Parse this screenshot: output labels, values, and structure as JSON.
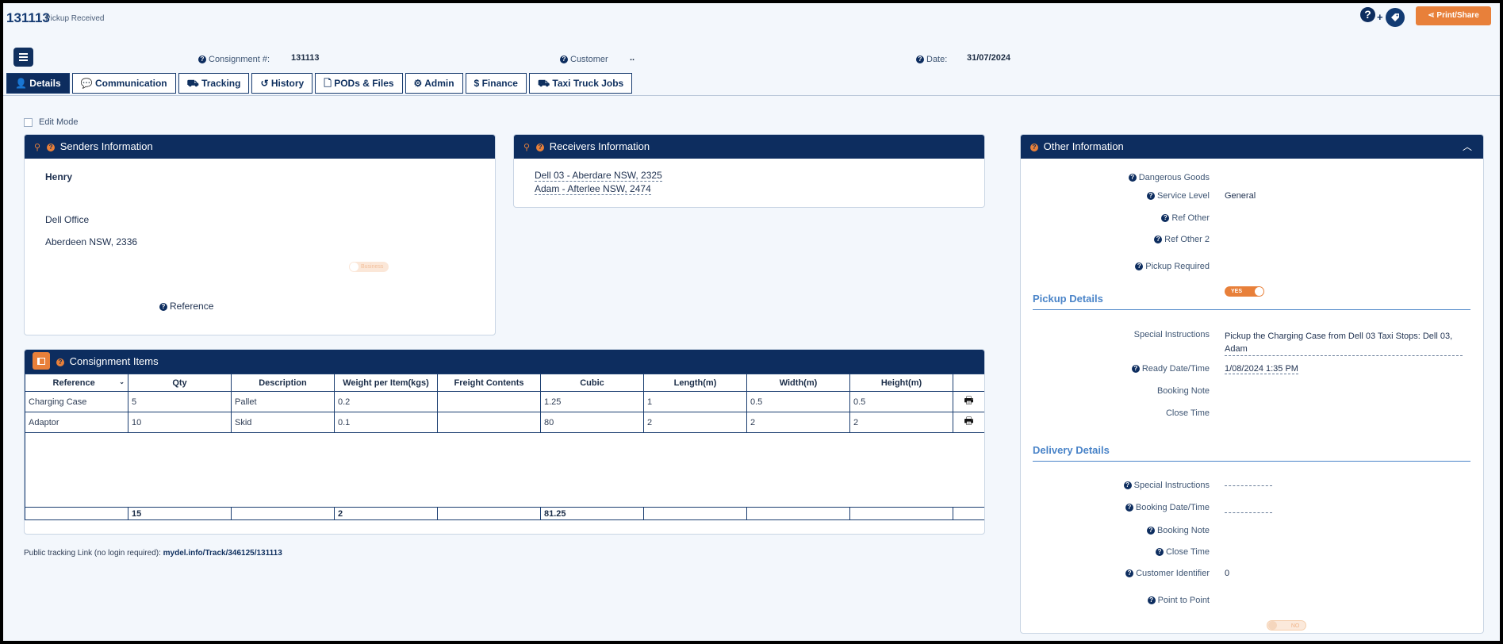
{
  "header": {
    "consignment_number": "131113",
    "status": "Pickup Received",
    "help_symbol": "?",
    "plus_symbol": "+",
    "print_share_label": "Print/Share"
  },
  "info_bar": {
    "consignment_label": "Consignment #:",
    "consignment_value": "131113",
    "customer_label": "Customer",
    "customer_value": "..",
    "date_label": "Date:",
    "date_value": "31/07/2024"
  },
  "tabs": [
    {
      "label": "Details",
      "icon": "user-icon",
      "active": true
    },
    {
      "label": "Communication",
      "icon": "chat-icon",
      "active": false
    },
    {
      "label": "Tracking",
      "icon": "truck-icon",
      "active": false
    },
    {
      "label": "History",
      "icon": "history-icon",
      "active": false
    },
    {
      "label": "PODs & Files",
      "icon": "file-icon",
      "active": false
    },
    {
      "label": "Admin",
      "icon": "gear-icon",
      "active": false
    },
    {
      "label": "Finance",
      "icon": "dollar-icon",
      "active": false
    },
    {
      "label": "Taxi Truck Jobs",
      "icon": "truck-icon",
      "active": false
    }
  ],
  "edit_mode_label": "Edit Mode",
  "senders": {
    "title": "Senders Information",
    "name": "Henry",
    "company": "Dell Office",
    "suburb": "Aberdeen NSW, 2336",
    "toggle_label": "Business",
    "reference_label": "Reference"
  },
  "receivers": {
    "title": "Receivers Information",
    "lines": [
      "Dell 03 - Aberdare NSW, 2325",
      "Adam - Afterlee NSW, 2474"
    ]
  },
  "items": {
    "title": "Consignment Items",
    "columns": [
      "Reference",
      "Qty",
      "Description",
      "Weight per Item(kgs)",
      "Freight Contents",
      "Cubic",
      "Length(m)",
      "Width(m)",
      "Height(m)"
    ],
    "rows": [
      [
        "Charging Case",
        "5",
        "Pallet",
        "0.2",
        "",
        "1.25",
        "1",
        "0.5",
        "0.5"
      ],
      [
        "Adaptor",
        "10",
        "Skid",
        "0.1",
        "",
        "80",
        "2",
        "2",
        "2"
      ]
    ],
    "totals": [
      "",
      "15",
      "",
      "2",
      "",
      "81.25",
      "",
      "",
      ""
    ],
    "print_icon": "🖶"
  },
  "tracking": {
    "label": "Public tracking Link (no login required):",
    "link": "mydel.info/Track/346125/131113"
  },
  "other": {
    "title": "Other Information",
    "dangerous_goods_label": "Dangerous Goods",
    "service_level_label": "Service Level",
    "service_level_value": "General",
    "ref_other_label": "Ref Other",
    "ref_other2_label": "Ref Other 2",
    "pickup_required_label": "Pickup Required",
    "pickup_required_toggle": "YES",
    "pickup_details_title": "Pickup Details",
    "pickup_special_label": "Special Instructions",
    "pickup_special_value": "Pickup the Charging Case from Dell 03 Taxi Stops: Dell 03, Adam",
    "ready_label": "Ready Date/Time",
    "ready_value": "1/08/2024 1:35 PM",
    "pickup_booking_note_label": "Booking Note",
    "pickup_close_time_label": "Close Time",
    "delivery_details_title": "Delivery Details",
    "delivery_special_label": "Special Instructions",
    "booking_datetime_label": "Booking Date/Time",
    "delivery_booking_note_label": "Booking Note",
    "delivery_close_time_label": "Close Time",
    "customer_identifier_label": "Customer Identifier",
    "customer_identifier_value": "0",
    "point_to_point_label": "Point to Point",
    "point_to_point_toggle": "NO"
  },
  "colors": {
    "navy": "#0d2d5f",
    "orange": "#e8803a",
    "link_blue": "#4a84c8",
    "background": "#f3f7fc"
  }
}
